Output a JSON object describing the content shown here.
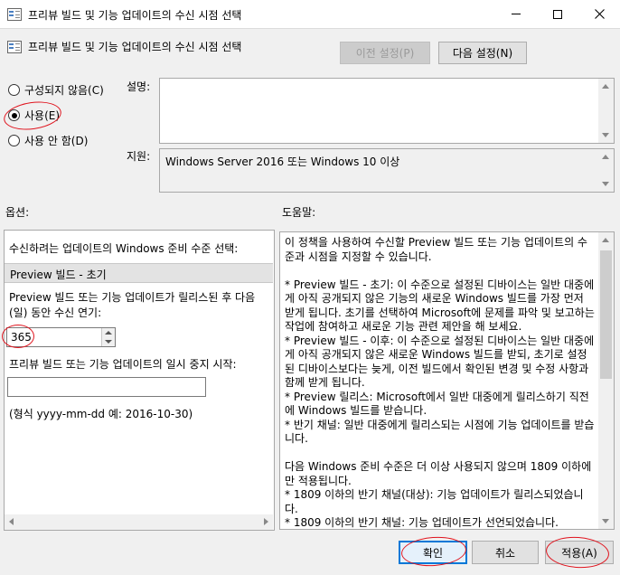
{
  "window": {
    "title": "프리뷰 빌드 및 기능 업데이트의 수신 시점 선택"
  },
  "header": {
    "title": "프리뷰 빌드 및 기능 업데이트의 수신 시점 선택",
    "prev_setting_label": "이전 설정(P)",
    "next_setting_label": "다음 설정(N)"
  },
  "state": {
    "radios": [
      {
        "label": "구성되지 않음(C)",
        "selected": false
      },
      {
        "label": "사용(E)",
        "selected": true
      },
      {
        "label": "사용 안 함(D)",
        "selected": false
      }
    ]
  },
  "comment": {
    "label": "설명:",
    "value": ""
  },
  "supported": {
    "label": "지원:",
    "value": "Windows Server 2016 또는 Windows 10 이상"
  },
  "options": {
    "label": "옵션:",
    "select_level_label": "수신하려는  업데이트의 Windows 준비 수준 선택:",
    "selected_level": "Preview 빌드 - 초기",
    "defer_label": "Preview 빌드 또는 기능 업데이트가 릴리스된 후 다음(일) 동안 수신 연기:",
    "defer_value": "365",
    "pause_label": "프리뷰 빌드 또는 기능 업데이트의 일시 중지 시작:",
    "pause_value": "",
    "format_hint": "(형식 yyyy-mm-dd 예: 2016-10-30)"
  },
  "help": {
    "label": "도움말:",
    "text": "이 정책을 사용하여 수신할 Preview 빌드 또는 기능 업데이트의 수준과 시점을 지정할 수 있습니다.\n\n* Preview 빌드 - 초기: 이 수준으로 설정된 디바이스는 일반 대중에게 아직 공개되지 않은 기능의 새로운 Windows 빌드를 가장 먼저 받게 됩니다. 초기를 선택하여 Microsoft에 문제를 파악 및 보고하는 작업에 참여하고 새로운 기능 관련 제안을 해 보세요.\n* Preview 빌드 - 이후: 이 수준으로 설정된 디바이스는 일반 대중에게 아직 공개되지 않은 새로운 Windows 빌드를 받되, 초기로 설정된 디바이스보다는 늦게, 이전 빌드에서 확인된 변경 및 수정 사항과 함께 받게 됩니다.\n* Preview 릴리스: Microsoft에서 일반 대중에게 릴리스하기 직전에 Windows 빌드를 받습니다.\n* 반기 채널: 일반 대중에게 릴리스되는 시점에 기능 업데이트를 받습니다.\n\n다음 Windows 준비 수준은 더 이상 사용되지 않으며 1809 이하에만 적용됩니다.\n* 1809 이하의 반기 채널(대상): 기능 업데이트가 릴리스되었습니다.\n* 1809 이하의 반기 채널: 기능 업데이트가 선언되었습니다."
  },
  "footer": {
    "ok_label": "확인",
    "cancel_label": "취소",
    "apply_label": "적용(A)"
  },
  "colors": {
    "accent": "#0078d7",
    "annotation": "#e0141e"
  }
}
